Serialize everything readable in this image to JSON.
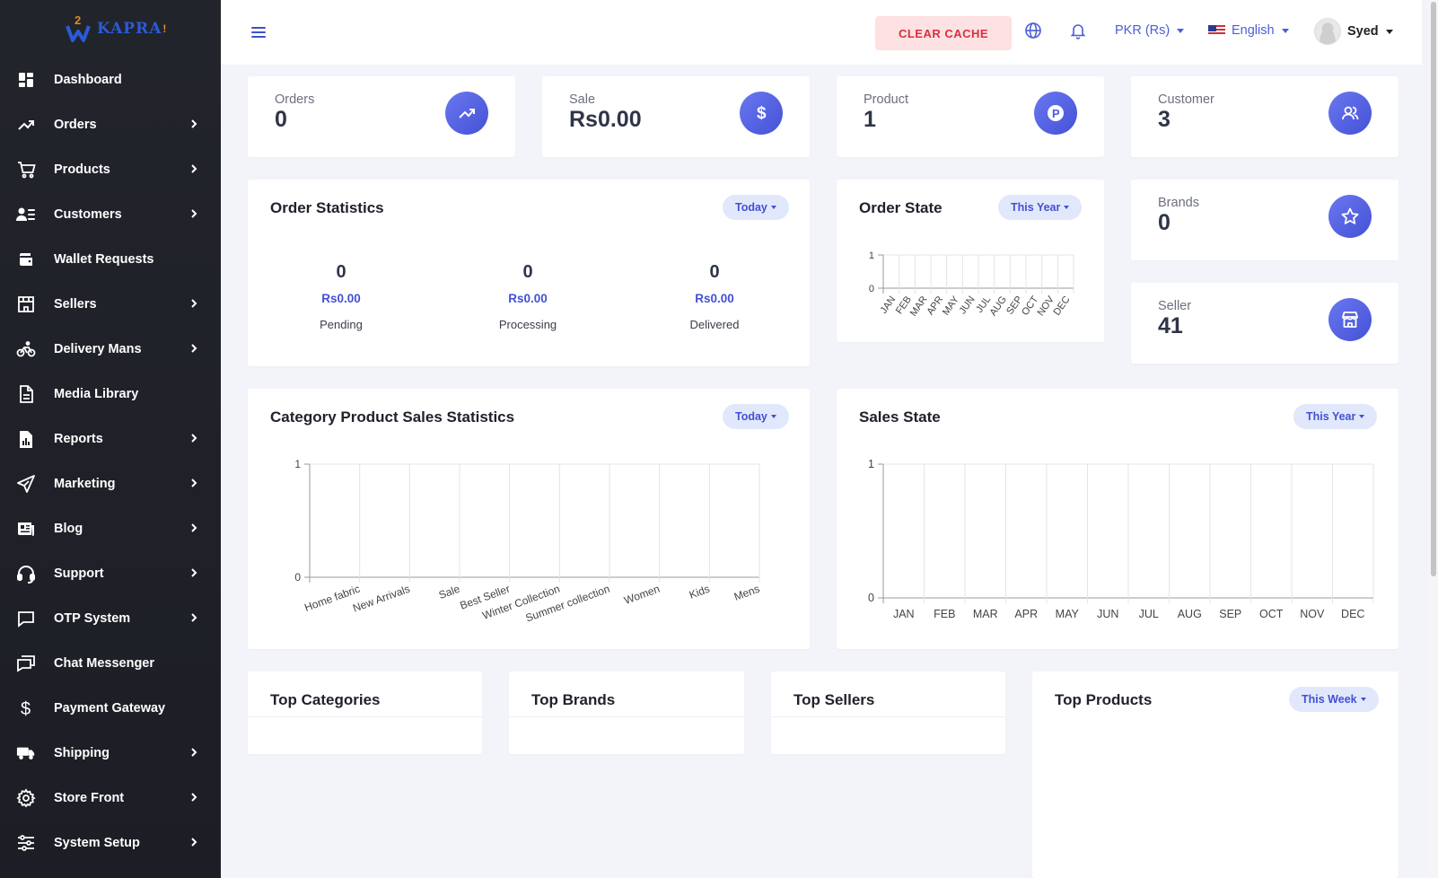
{
  "logo": {
    "text": "KAPRA",
    "badge": "2"
  },
  "sidebar": {
    "items": [
      {
        "label": "Dashboard",
        "icon": "dashboard-icon",
        "has_children": false
      },
      {
        "label": "Orders",
        "icon": "trending-up-icon",
        "has_children": true
      },
      {
        "label": "Products",
        "icon": "cart-icon",
        "has_children": true
      },
      {
        "label": "Customers",
        "icon": "customers-icon",
        "has_children": true
      },
      {
        "label": "Wallet Requests",
        "icon": "wallet-icon",
        "has_children": false
      },
      {
        "label": "Sellers",
        "icon": "store-icon",
        "has_children": true
      },
      {
        "label": "Delivery Mans",
        "icon": "bicycle-icon",
        "has_children": true
      },
      {
        "label": "Media Library",
        "icon": "document-icon",
        "has_children": false
      },
      {
        "label": "Reports",
        "icon": "report-icon",
        "has_children": true
      },
      {
        "label": "Marketing",
        "icon": "send-icon",
        "has_children": true
      },
      {
        "label": "Blog",
        "icon": "newspaper-icon",
        "has_children": true
      },
      {
        "label": "Support",
        "icon": "headset-icon",
        "has_children": true
      },
      {
        "label": "OTP System",
        "icon": "chat-square-icon",
        "has_children": true
      },
      {
        "label": "Chat Messenger",
        "icon": "chat-double-icon",
        "has_children": false
      },
      {
        "label": "Payment Gateway",
        "icon": "dollar-icon",
        "has_children": false
      },
      {
        "label": "Shipping",
        "icon": "truck-icon",
        "has_children": true
      },
      {
        "label": "Store Front",
        "icon": "gear-icon",
        "has_children": true
      },
      {
        "label": "System Setup",
        "icon": "sliders-icon",
        "has_children": true
      }
    ]
  },
  "topbar": {
    "clear_cache": "CLEAR CACHE",
    "currency": "PKR (Rs)",
    "language": "English",
    "user_name": "Syed"
  },
  "stats": {
    "orders": {
      "label": "Orders",
      "value": "0",
      "icon": "trending-up-icon"
    },
    "sale": {
      "label": "Sale",
      "value": "Rs0.00",
      "icon": "dollar-icon"
    },
    "product": {
      "label": "Product",
      "value": "1",
      "icon": "p-icon"
    },
    "customer": {
      "label": "Customer",
      "value": "3",
      "icon": "users-icon"
    },
    "brands": {
      "label": "Brands",
      "value": "0",
      "icon": "star-icon"
    },
    "seller": {
      "label": "Seller",
      "value": "41",
      "icon": "store-icon"
    }
  },
  "order_statistics": {
    "title": "Order Statistics",
    "filter": "Today",
    "columns": [
      {
        "count": "0",
        "amount": "Rs0.00",
        "label": "Pending"
      },
      {
        "count": "0",
        "amount": "Rs0.00",
        "label": "Processing"
      },
      {
        "count": "0",
        "amount": "Rs0.00",
        "label": "Delivered"
      }
    ]
  },
  "order_state": {
    "title": "Order State",
    "filter": "This Year"
  },
  "category_sales": {
    "title": "Category Product Sales Statistics",
    "filter": "Today"
  },
  "sales_state": {
    "title": "Sales State",
    "filter": "This Year"
  },
  "bottom": {
    "top_categories": "Top Categories",
    "top_brands": "Top Brands",
    "top_sellers": "Top Sellers",
    "top_products": "Top Products",
    "top_products_filter": "This Week"
  },
  "colors": {
    "accent": "#4a5ed8",
    "sidebar": "#1f2028",
    "danger": "#d9303e"
  },
  "chart_data": [
    {
      "id": "order_state",
      "type": "line",
      "categories": [
        "JAN",
        "FEB",
        "MAR",
        "APR",
        "MAY",
        "JUN",
        "JUL",
        "AUG",
        "SEP",
        "OCT",
        "NOV",
        "DEC"
      ],
      "values": [
        0,
        0,
        0,
        0,
        0,
        0,
        0,
        0,
        0,
        0,
        0,
        0
      ],
      "ylim": [
        0,
        1
      ],
      "yticks": [
        "0",
        "1"
      ],
      "grid": true
    },
    {
      "id": "category_sales",
      "type": "bar",
      "categories": [
        "Home fabric",
        "New Arrivals",
        "Sale",
        "Best Seller",
        "Winter Collection",
        "Summer collection",
        "Women",
        "Kids",
        "Mens"
      ],
      "values": [
        0,
        0,
        0,
        0,
        0,
        0,
        0,
        0,
        0
      ],
      "ylim": [
        0,
        1
      ],
      "yticks": [
        "0",
        "1"
      ],
      "grid": true
    },
    {
      "id": "sales_state",
      "type": "bar",
      "categories": [
        "JAN",
        "FEB",
        "MAR",
        "APR",
        "MAY",
        "JUN",
        "JUL",
        "AUG",
        "SEP",
        "OCT",
        "NOV",
        "DEC"
      ],
      "values": [
        0,
        0,
        0,
        0,
        0,
        0,
        0,
        0,
        0,
        0,
        0,
        0
      ],
      "ylim": [
        0,
        1
      ],
      "yticks": [
        "0",
        "1"
      ],
      "grid": true
    }
  ]
}
